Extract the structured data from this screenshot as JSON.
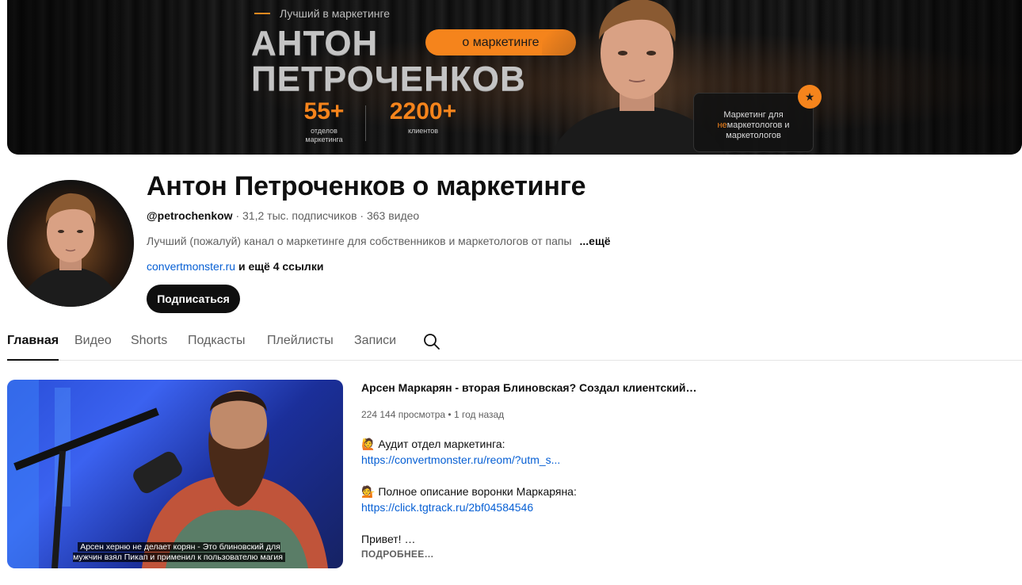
{
  "banner": {
    "tagline": "Лучший в маркетинге",
    "name_line1": "АНТОН",
    "name_line2": "ПЕТРОЧЕНКОВ",
    "pill": "о маркетинге",
    "stat1_value": "55+",
    "stat1_label_1": "отделов",
    "stat1_label_2": "маркетинга",
    "stat2_value": "2200+",
    "stat2_label": "клиентов",
    "card_line1": "Маркетинг для",
    "card_line2_accent": "не",
    "card_line2_rest": "маркетологов и",
    "card_line3": "маркетологов",
    "accent_color": "#f5841c"
  },
  "channel": {
    "title": "Антон Петроченков о маркетинге",
    "handle": "@petrochenkow",
    "subscribers": "31,2 тыс. подписчиков",
    "videos": "363 видео",
    "meta_separator": "·",
    "description": "Лучший (пожалуй) канал о маркетинге для собственников и маркетологов от папы",
    "description_more": "...ещё",
    "link": "convertmonster.ru",
    "more_links": "и ещё 4 ссылки",
    "subscribe_label": "Подписаться"
  },
  "tabs": [
    {
      "label": "Главная",
      "active": true
    },
    {
      "label": "Видео",
      "active": false
    },
    {
      "label": "Shorts",
      "active": false
    },
    {
      "label": "Подкасты",
      "active": false
    },
    {
      "label": "Плейлисты",
      "active": false
    },
    {
      "label": "Записи",
      "active": false
    }
  ],
  "search_icon": "search-icon",
  "featured": {
    "title": "Арсен Маркарян - вторая Блиновская? Создал клиентский…",
    "views": "224 144 просмотра",
    "age": "1 год назад",
    "meta_separator": "•",
    "caption": "Арсен херню не делает корян - Это блиновский для мужчин взял Пикап и применил к пользователю магия",
    "desc_line1": "🙋 Аудит отдел маркетинга:",
    "desc_link1": "https://convertmonster.ru/reom/?utm_s...",
    "desc_line2": "💁 Полное описание воронки Маркаряна:",
    "desc_link2": "https://click.tgtrack.ru/2bf04584546",
    "desc_line3": "Привет! …",
    "more_label": "ПОДРОБНЕЕ…"
  }
}
